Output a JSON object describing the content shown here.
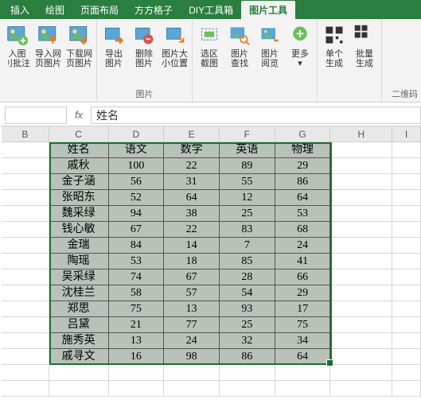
{
  "tabs": [
    "插入",
    "绘图",
    "页面布局",
    "方方格子",
    "DIY工具箱",
    "图片工具"
  ],
  "active_tab": 5,
  "ribbon": {
    "g1": [
      "入图",
      "刂批注"
    ],
    "g2": [
      "导入网",
      "页图片"
    ],
    "g3": [
      "下载网",
      "页图片"
    ],
    "g4": [
      "导出",
      "图片"
    ],
    "g5": [
      "删除",
      "图片"
    ],
    "g6": [
      "图片大",
      "小位置"
    ],
    "g1_label": "图片",
    "g7": [
      "选区",
      "截图"
    ],
    "g8": [
      "图片",
      "查找"
    ],
    "g9": [
      "图片",
      "阅览"
    ],
    "g10": "更多",
    "g11": [
      "单个",
      "生成"
    ],
    "g12": [
      "批量",
      "生成"
    ],
    "sub_qr": "二维码"
  },
  "formula_value": "姓名",
  "col_heads": [
    "B",
    "C",
    "D",
    "E",
    "F",
    "G",
    "H",
    "I"
  ],
  "chart_data": {
    "type": "table",
    "headers": [
      "姓名",
      "语文",
      "数学",
      "英语",
      "物理"
    ],
    "rows": [
      [
        "戚秋",
        100,
        22,
        89,
        29
      ],
      [
        "金子涵",
        56,
        31,
        55,
        86
      ],
      [
        "张昭东",
        52,
        64,
        12,
        64
      ],
      [
        "魏采绿",
        94,
        38,
        25,
        53
      ],
      [
        "钱心敏",
        67,
        22,
        83,
        68
      ],
      [
        "金瑞",
        84,
        14,
        7,
        24
      ],
      [
        "陶瑶",
        53,
        18,
        85,
        41
      ],
      [
        "吴采绿",
        74,
        67,
        28,
        66
      ],
      [
        "沈桂兰",
        58,
        57,
        54,
        29
      ],
      [
        "郑思",
        75,
        13,
        93,
        17
      ],
      [
        "吕黛",
        21,
        77,
        25,
        75
      ],
      [
        "施秀英",
        13,
        24,
        32,
        34
      ],
      [
        "戚寻文",
        16,
        98,
        86,
        64
      ]
    ]
  }
}
